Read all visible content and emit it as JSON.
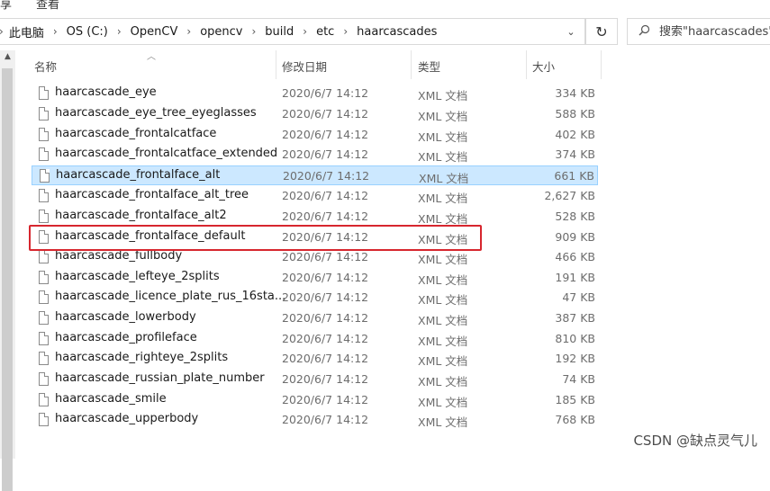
{
  "ribbon": {
    "items": [
      "享",
      "查看"
    ]
  },
  "address": {
    "breadcrumbs": [
      "此电脑",
      "OS (C:)",
      "OpenCV",
      "opencv",
      "build",
      "etc",
      "haarcascades"
    ],
    "separator": "›",
    "dropdown_glyph": "⌄"
  },
  "refresh_glyph": "↻",
  "search": {
    "placeholder": "搜索\"haarcascades\"",
    "icon": "search-icon"
  },
  "columns": {
    "name": "名称",
    "date": "修改日期",
    "type": "类型",
    "size": "大小"
  },
  "files": [
    {
      "name": "haarcascade_eye",
      "date": "2020/6/7 14:12",
      "type": "XML 文档",
      "size": "334 KB"
    },
    {
      "name": "haarcascade_eye_tree_eyeglasses",
      "date": "2020/6/7 14:12",
      "type": "XML 文档",
      "size": "588 KB"
    },
    {
      "name": "haarcascade_frontalcatface",
      "date": "2020/6/7 14:12",
      "type": "XML 文档",
      "size": "402 KB"
    },
    {
      "name": "haarcascade_frontalcatface_extended",
      "date": "2020/6/7 14:12",
      "type": "XML 文档",
      "size": "374 KB"
    },
    {
      "name": "haarcascade_frontalface_alt",
      "date": "2020/6/7 14:12",
      "type": "XML 文档",
      "size": "661 KB"
    },
    {
      "name": "haarcascade_frontalface_alt_tree",
      "date": "2020/6/7 14:12",
      "type": "XML 文档",
      "size": "2,627 KB"
    },
    {
      "name": "haarcascade_frontalface_alt2",
      "date": "2020/6/7 14:12",
      "type": "XML 文档",
      "size": "528 KB"
    },
    {
      "name": "haarcascade_frontalface_default",
      "date": "2020/6/7 14:12",
      "type": "XML 文档",
      "size": "909 KB"
    },
    {
      "name": "haarcascade_fullbody",
      "date": "2020/6/7 14:12",
      "type": "XML 文档",
      "size": "466 KB"
    },
    {
      "name": "haarcascade_lefteye_2splits",
      "date": "2020/6/7 14:12",
      "type": "XML 文档",
      "size": "191 KB"
    },
    {
      "name": "haarcascade_licence_plate_rus_16sta...",
      "date": "2020/6/7 14:12",
      "type": "XML 文档",
      "size": "47 KB"
    },
    {
      "name": "haarcascade_lowerbody",
      "date": "2020/6/7 14:12",
      "type": "XML 文档",
      "size": "387 KB"
    },
    {
      "name": "haarcascade_profileface",
      "date": "2020/6/7 14:12",
      "type": "XML 文档",
      "size": "810 KB"
    },
    {
      "name": "haarcascade_righteye_2splits",
      "date": "2020/6/7 14:12",
      "type": "XML 文档",
      "size": "192 KB"
    },
    {
      "name": "haarcascade_russian_plate_number",
      "date": "2020/6/7 14:12",
      "type": "XML 文档",
      "size": "74 KB"
    },
    {
      "name": "haarcascade_smile",
      "date": "2020/6/7 14:12",
      "type": "XML 文档",
      "size": "185 KB"
    },
    {
      "name": "haarcascade_upperbody",
      "date": "2020/6/7 14:12",
      "type": "XML 文档",
      "size": "768 KB"
    }
  ],
  "selected_file": "haarcascade_frontalface_alt",
  "highlighted_file": "haarcascade_frontalface_default",
  "watermark": "CSDN @缺点灵气儿",
  "colors": {
    "selection_bg": "#cce8ff",
    "selection_border": "#99d1ff",
    "highlight_box": "#d7262e"
  }
}
